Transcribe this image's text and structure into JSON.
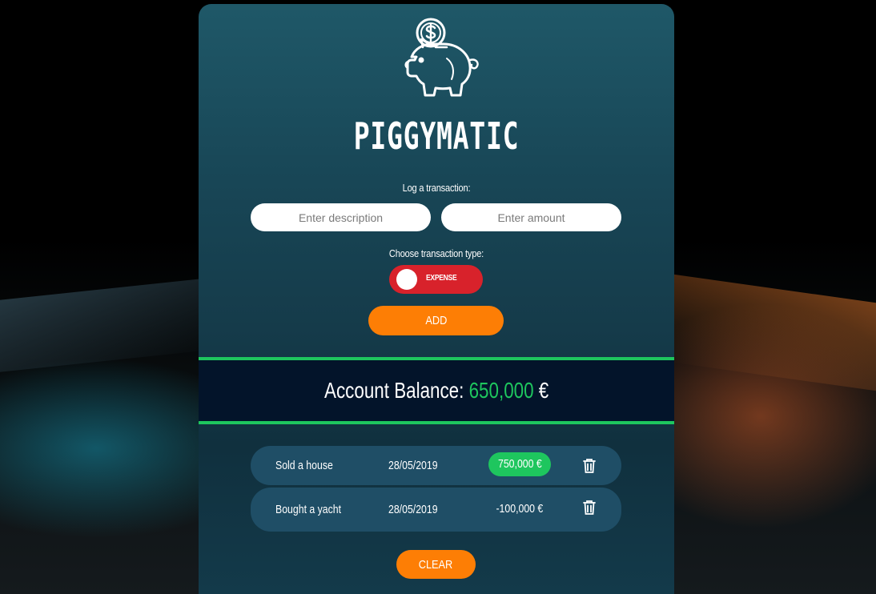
{
  "app": {
    "title": "PIGGYMATIC"
  },
  "form": {
    "log_label": "Log a transaction:",
    "description_placeholder": "Enter description",
    "amount_placeholder": "Enter amount",
    "type_label": "Choose transaction type:",
    "type_toggle": {
      "selected": "EXPENSE",
      "color": "#d8222b"
    },
    "add_label": "ADD"
  },
  "balance": {
    "label": "Account Balance:",
    "value": "650,000",
    "currency": "€",
    "value_color": "#1ec65e"
  },
  "transactions": [
    {
      "description": "Sold a house",
      "date": "28/05/2019",
      "amount": "750,000 €",
      "type": "income"
    },
    {
      "description": "Bought a yacht",
      "date": "28/05/2019",
      "amount": "-100,000 €",
      "type": "expense"
    }
  ],
  "clear_label": "CLEAR",
  "icons": {
    "logo": "piggy-bank-coin-icon",
    "delete": "trash-icon"
  },
  "colors": {
    "accent": "#fd7e05",
    "success": "#1ec65e",
    "danger": "#d8222b",
    "row_bg": "#1f4e66",
    "balance_bg": "#03142a"
  }
}
